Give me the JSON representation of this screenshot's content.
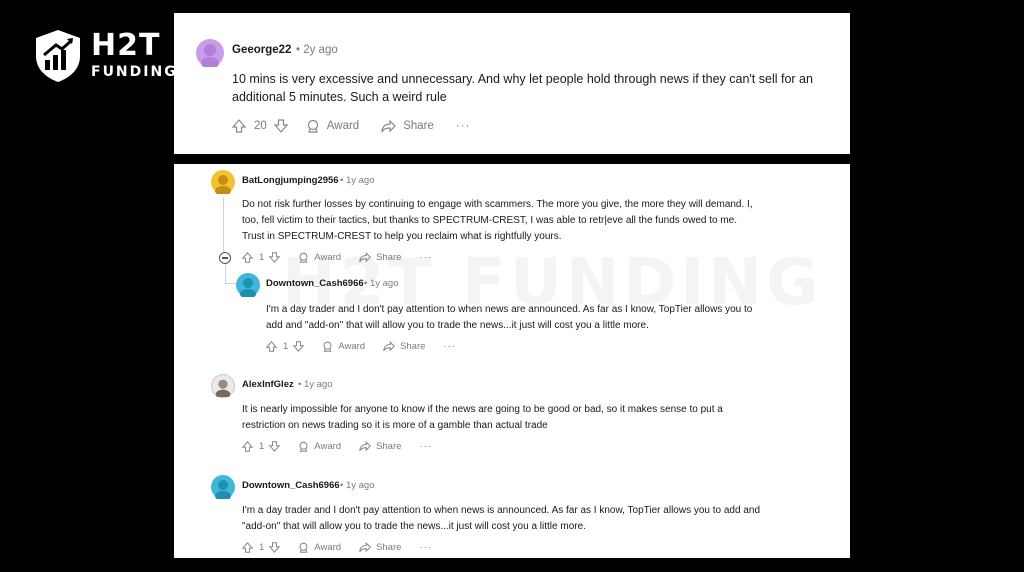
{
  "brand": {
    "line1": "H2T",
    "line2": "FUNDING",
    "watermark": "H2T FUNDING"
  },
  "comments": [
    {
      "username": "Geeorge22",
      "age": "• 2y ago",
      "text": "10 mins is very excessive and unnecessary. And why let people hold through news if they can't sell for an additional 5 minutes. Such a weird rule",
      "votes": "20",
      "award": "Award",
      "share": "Share",
      "more": "···",
      "avatar_color": "#c89ce8"
    },
    {
      "username": "BatLongjumping2956",
      "age": "• 1y ago",
      "text": "Do not risk further losses by continuing to engage with scammers. The more you give, the more they will demand. I, too, fell victim to their tactics, but thanks to SPECTRUM-CREST, I was able to retr|eve all the funds owed to me. Trust in SPECTRUM-CREST to help you reclaim what is rightfully yours.",
      "votes": "1",
      "award": "Award",
      "share": "Share",
      "more": "···",
      "avatar_color": "#f2c230"
    },
    {
      "username": "Downtown_Cash6966",
      "age": "• 1y ago",
      "text": "I'm a day trader and I don't pay attention to when news are announced. As far as I know, TopTier allows you to add and \"add-on\" that will allow you to trade the news...it just will cost you a little more.",
      "votes": "1",
      "award": "Award",
      "share": "Share",
      "more": "···",
      "avatar_color": "#3fb8d8"
    },
    {
      "username": "AlexInfGlez",
      "age": "• 1y ago",
      "text": "It is nearly impossible for anyone to know if the news are going to be good or bad, so it makes sense to put a restriction on news trading so it is more of a gamble than actual trade",
      "votes": "1",
      "award": "Award",
      "share": "Share",
      "more": "···",
      "avatar_color": "#d9d9d9"
    },
    {
      "username": "Downtown_Cash6966",
      "age": "• 1y ago",
      "text": "I'm a day trader and I don't pay attention to when news is announced. As far as I know, TopTier allows you to add and \"add-on\" that will allow you to trade the news...it just will cost you a little more.",
      "votes": "1",
      "award": "Award",
      "share": "Share",
      "more": "···",
      "avatar_color": "#3fb8d8"
    }
  ]
}
